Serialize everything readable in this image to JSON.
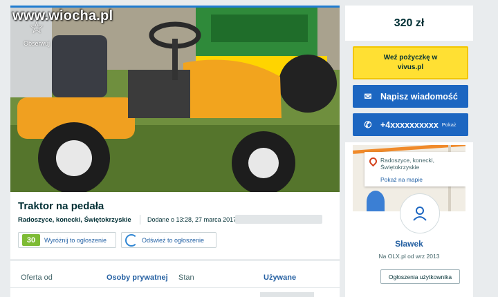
{
  "watermark": "www.wiocha.pl",
  "gallery": {
    "follow_label": "Obserwuj",
    "follow_icon": "star-icon"
  },
  "listing": {
    "title": "Traktor na pedała",
    "location": "Radoszyce, konecki, Świętokrzyskie",
    "added": "Dodane o 13:28, 27 marca 2017,",
    "promote_label": "Wyróżnij to ogłoszenie",
    "promote_badge": "30",
    "refresh_label": "Odśwież to ogłoszenie"
  },
  "details": {
    "offer_label": "Oferta od",
    "offer_value": "Osoby prywatnej",
    "condition_label": "Stan",
    "condition_value": "Używane"
  },
  "sidebar": {
    "price": "320 zł",
    "loan_line1": "Weź pożyczkę w",
    "loan_line2": "vivus.pl",
    "message_label": "Napisz wiadomość",
    "phone_number": "+4xxxxxxxxxx",
    "phone_show": "Pokaż",
    "map_address": "Radoszyce, konecki, Świętokrzyskie",
    "map_link": "Pokaż na mapie",
    "user_name": "Sławek",
    "user_since": "Na OLX.pl od wrz 2013",
    "user_ads_label": "Ogłoszenia użytkownika"
  },
  "colors": {
    "accent_blue": "#1c66c1",
    "loan_yellow": "#ffe033",
    "text_dark": "#002f34"
  }
}
